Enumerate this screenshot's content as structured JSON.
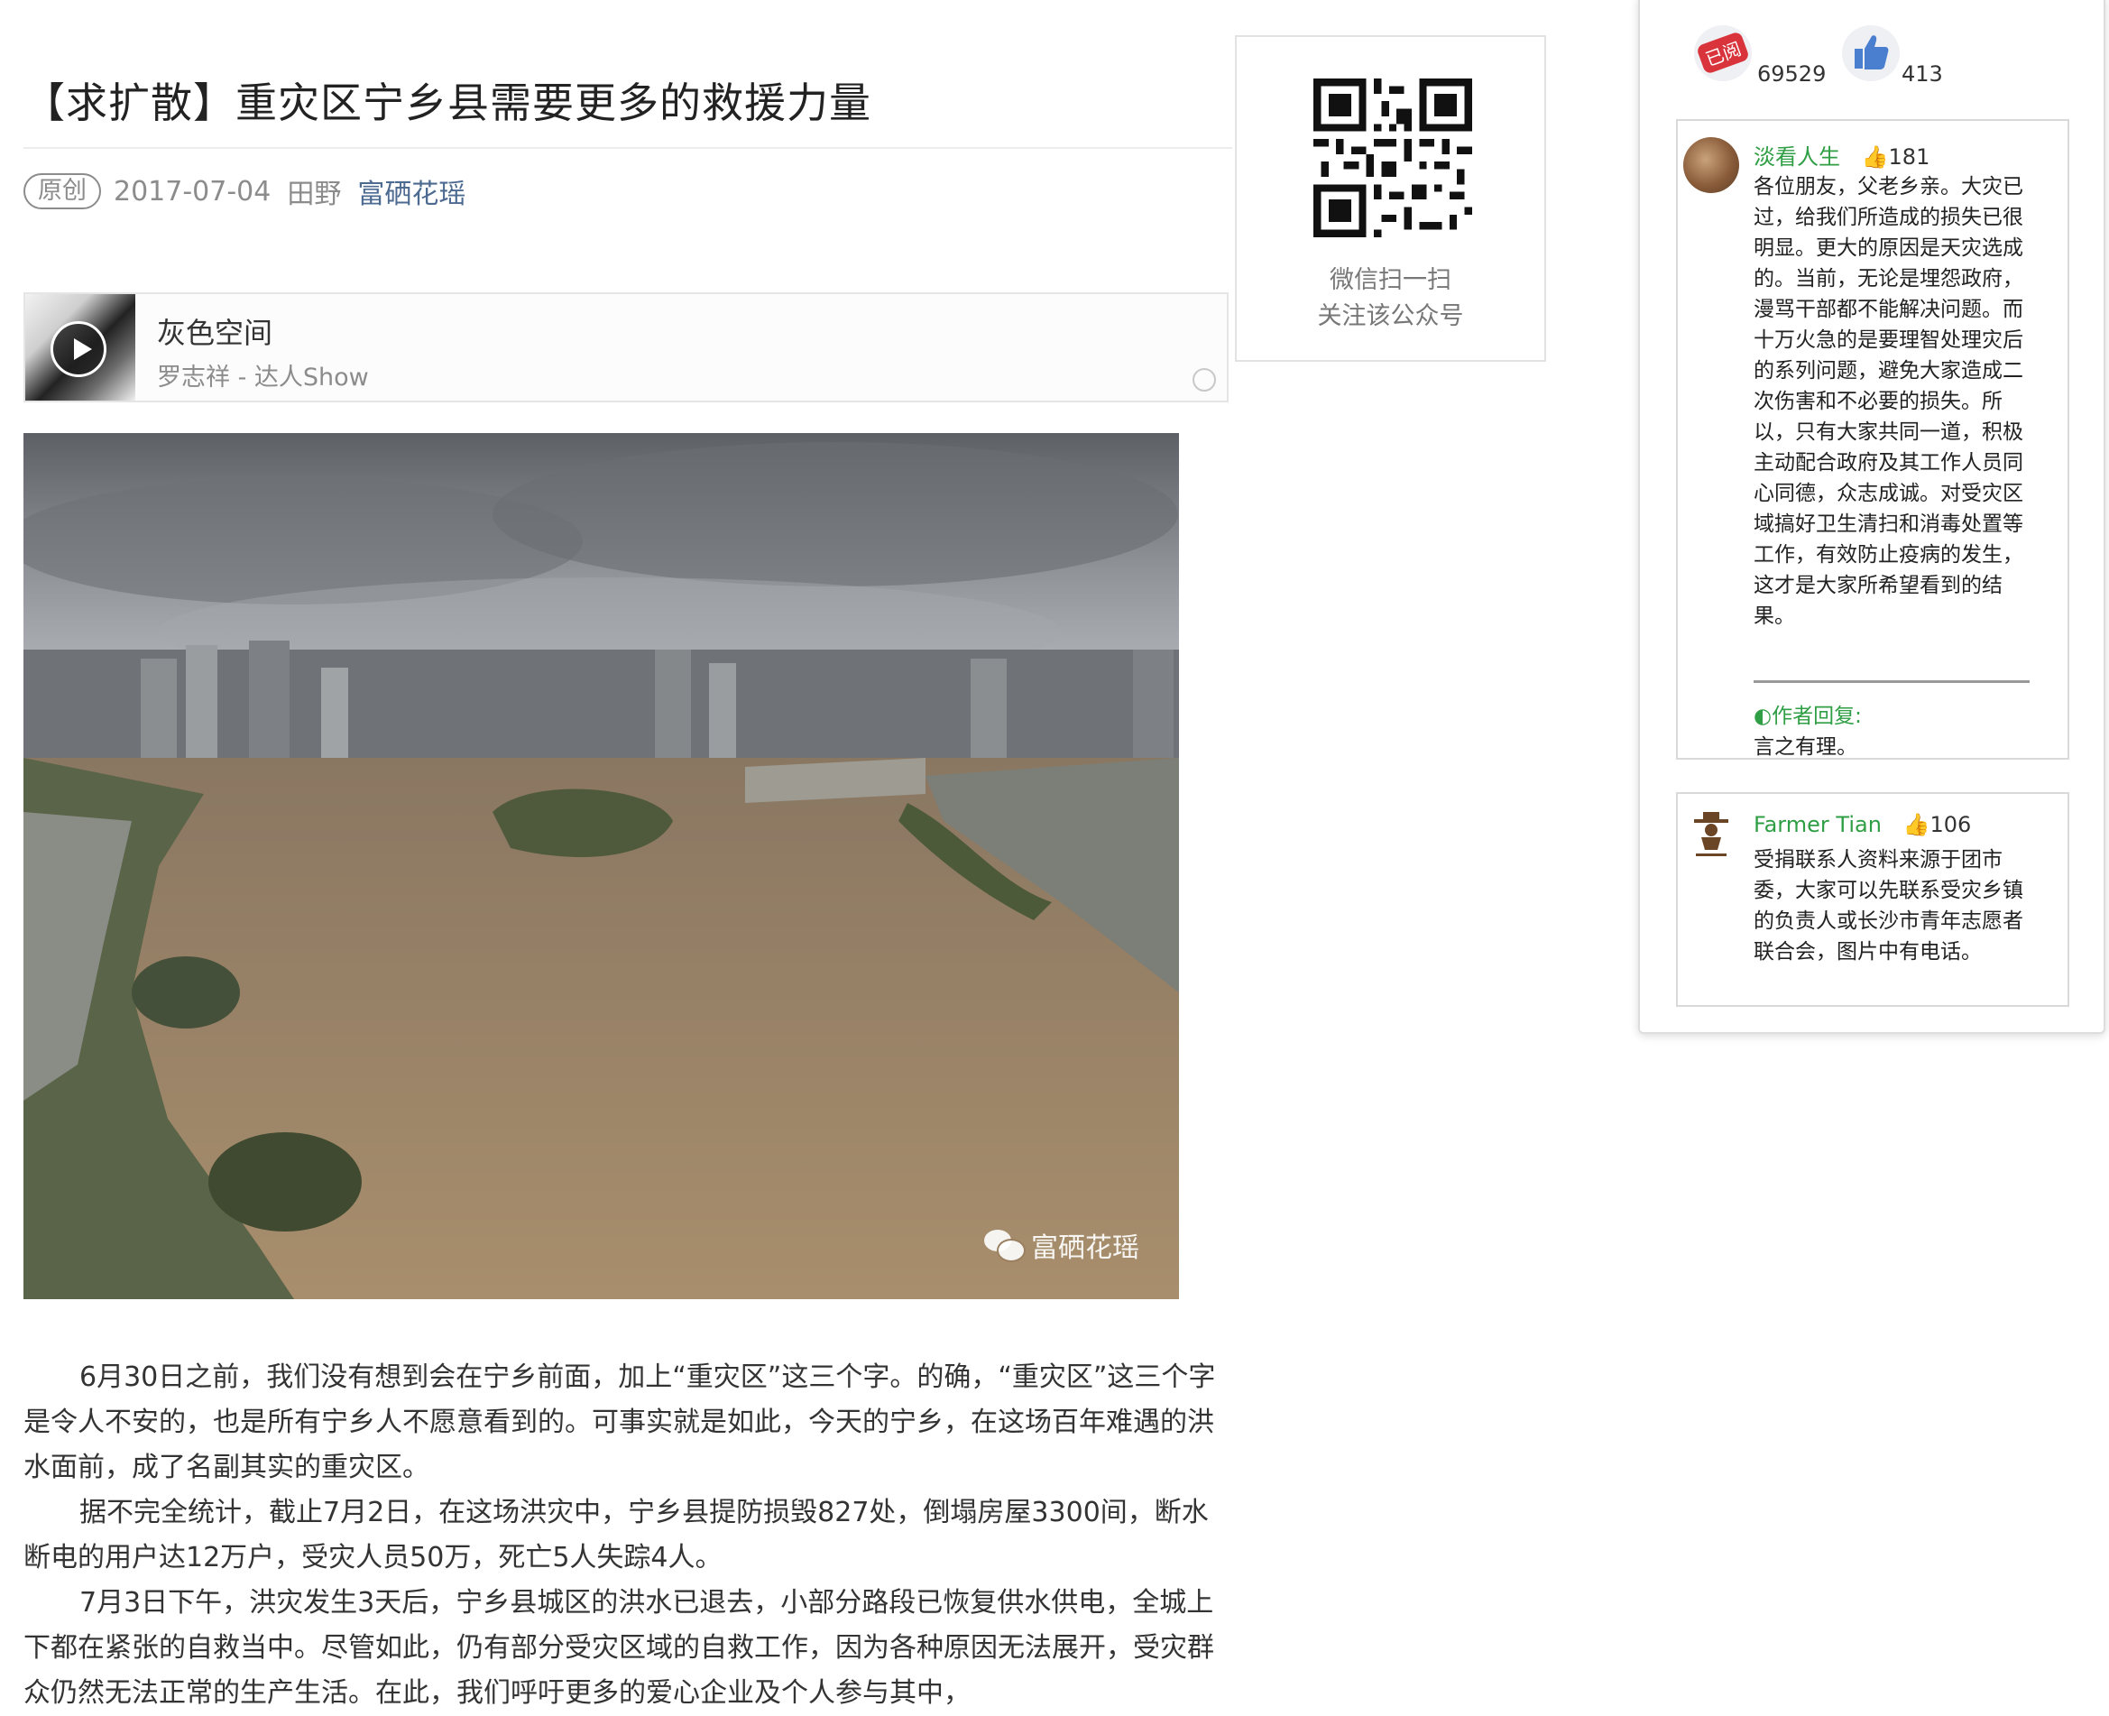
{
  "article": {
    "title": "【求扩散】重灾区宁乡县需要更多的救援力量",
    "badge": "原创",
    "date": "2017-07-04",
    "author": "田野",
    "account": "富硒花瑶"
  },
  "music": {
    "song": "灰色空间",
    "singer": "罗志祥 - 达人Show"
  },
  "photo": {
    "watermark": "富硒花瑶"
  },
  "paragraphs": [
    "6月30日之前，我们没有想到会在宁乡前面，加上“重灾区”这三个字。的确，“重灾区”这三个字是令人不安的，也是所有宁乡人不愿意看到的。可事实就是如此，今天的宁乡，在这场百年难遇的洪水面前，成了名副其实的重灾区。",
    "据不完全统计，截止7月2日，在这场洪灾中，宁乡县提防损毁827处，倒塌房屋3300间，断水断电的用户达12万户，受灾人员50万，死亡5人失踪4人。",
    "7月3日下午，洪灾发生3天后，宁乡县城区的洪水已退去，小部分路段已恢复供水供电，全城上下都在紧张的自救当中。尽管如此，仍有部分受灾区域的自救工作，因为各种原因无法展开，受灾群众仍然无法正常的生产生活。在此，我们呼吁更多的爱心企业及个人参与其中，"
  ],
  "qr": {
    "line1": "微信扫一扫",
    "line2": "关注该公众号"
  },
  "stats": {
    "read_badge": "已阅",
    "reads": "69529",
    "likes": "413"
  },
  "comments": [
    {
      "name": "淡看人生",
      "likes": "181",
      "text": "各位朋友，父老乡亲。大灾已过，给我们所造成的损失已很明显。更大的原因是天灾选成的。当前，无论是埋怨政府，漫骂干部都不能解决问题。而十万火急的是要理智处理灾后的系列问题，避免大家造成二次伤害和不必要的损失。所以，只有大家共同一道，积极主动配合政府及其工作人员同心同德，众志成诚。对受灾区域搞好卫生清扫和消毒处置等工作，有效防止疫病的发生，这才是大家所希望看到的结果。",
      "reply_label": "◐作者回复:",
      "reply_text": "言之有理。"
    },
    {
      "name": "Farmer Tian",
      "likes": "106",
      "text": "受捐联系人资料来源于团市委，大家可以先联系受灾乡镇的负责人或长沙市青年志愿者联合会，图片中有电话。"
    }
  ]
}
